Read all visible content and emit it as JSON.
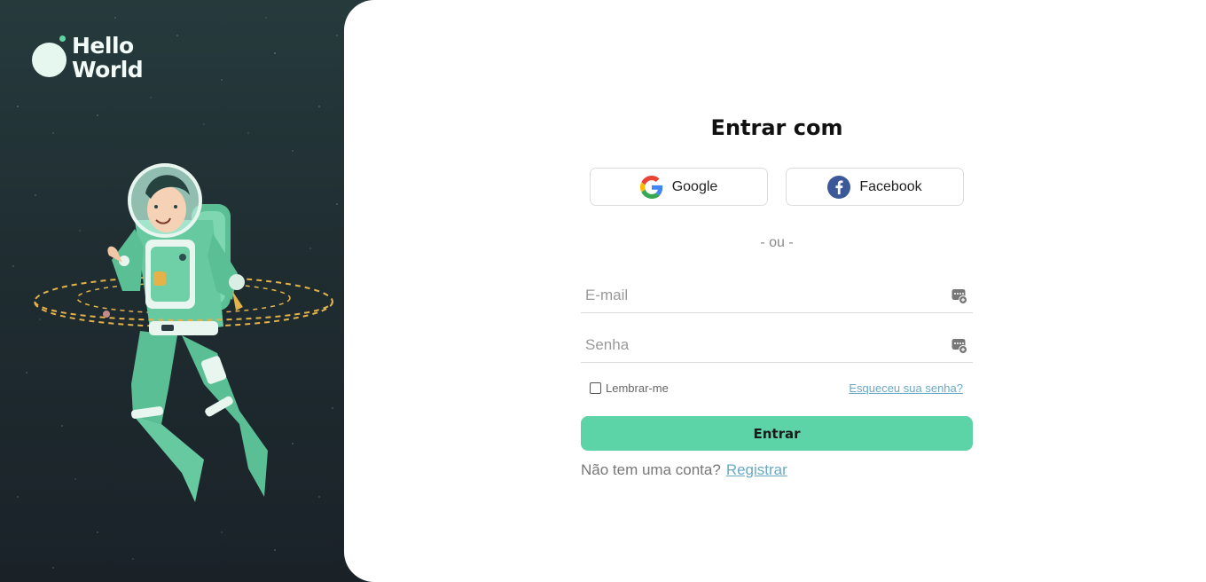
{
  "brand": {
    "name": "Hello\nWorld",
    "logo_color": "#e6f7f0",
    "accent": "#5fd4a5"
  },
  "login": {
    "title": "Entrar com",
    "google_label": "Google",
    "facebook_label": "Facebook",
    "divider": "- ou -",
    "email_placeholder": "E-mail",
    "password_placeholder": "Senha",
    "remember_label": "Lembrar-me",
    "remember_checked": false,
    "forgot_label": "Esqueceu sua senha?",
    "submit_label": "Entrar",
    "no_account_text": "Não tem uma conta?",
    "register_label": "Registrar",
    "field_icon": "password-manager-key-icon",
    "colors": {
      "primary": "#5dd4a7",
      "link": "#6aa9c3",
      "left_background": "#1f2d31"
    }
  }
}
